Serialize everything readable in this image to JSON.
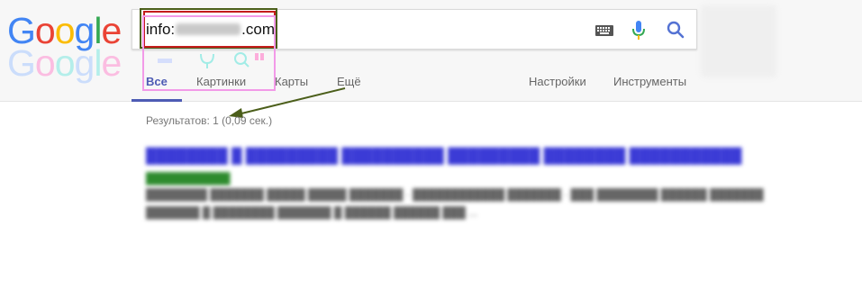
{
  "search": {
    "query_prefix": "info:",
    "query_suffix": ".com"
  },
  "logo": {
    "letters": [
      "G",
      "o",
      "o",
      "g",
      "l",
      "e"
    ]
  },
  "tabs": [
    {
      "label": "Все",
      "active": true
    },
    {
      "label": "Картинки"
    },
    {
      "label": "Карты"
    },
    {
      "label": "Ещё"
    },
    {
      "label": "Настройки"
    },
    {
      "label": "Инструменты"
    }
  ],
  "results": {
    "stats": "Результатов: 1 (0,09 сек.)"
  },
  "colors": {
    "accent": "#4d5bb4",
    "annotation_olive": "#4b5e1a",
    "annotation_red": "#c41c1c",
    "annotation_pink": "#f29ae8",
    "result_title": "#3b3bd6",
    "result_url": "#2e8b2e"
  },
  "icons": [
    "keyboard-icon",
    "microphone-icon",
    "search-icon"
  ]
}
